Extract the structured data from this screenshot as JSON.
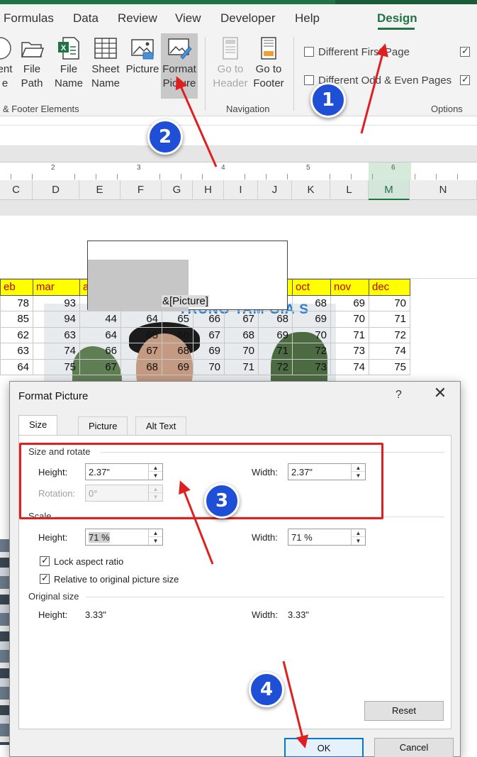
{
  "tabs": [
    {
      "label": "Formulas"
    },
    {
      "label": "Data"
    },
    {
      "label": "Review"
    },
    {
      "label": "View"
    },
    {
      "label": "Developer"
    },
    {
      "label": "Help"
    },
    {
      "label": "Design"
    }
  ],
  "ribbon": {
    "elements": {
      "current_line1": "ent",
      "current_line2": "e",
      "file_path_line1": "File",
      "file_path_line2": "Path",
      "file_name_line1": "File",
      "file_name_line2": "Name",
      "sheet_name_line1": "Sheet",
      "sheet_name_line2": "Name",
      "picture": "Picture",
      "format_picture_line1": "Format",
      "format_picture_line2": "Picture",
      "group_label": "& Footer Elements"
    },
    "navigation": {
      "goto_header_line1": "Go to",
      "goto_header_line2": "Header",
      "goto_footer_line1": "Go to",
      "goto_footer_line2": "Footer",
      "group_label": "Navigation"
    },
    "options": {
      "different_first_page": "Different First Page",
      "different_odd_even": "Different Odd & Even Pages",
      "group_label": "Options"
    }
  },
  "ruler": {
    "marks": [
      "2",
      "3",
      "4",
      "5",
      "6"
    ]
  },
  "columns": [
    "C",
    "D",
    "E",
    "F",
    "G",
    "H",
    "I",
    "J",
    "K",
    "L",
    "M",
    "N"
  ],
  "sheet": {
    "header_code": "&[Picture]",
    "watermark_text": "TRUNG TAM GIA S",
    "month_headers": [
      "eb",
      "mar",
      "a",
      "",
      "",
      "",
      "",
      "",
      "oct",
      "nov",
      "dec"
    ],
    "rows": [
      [
        "78",
        "93",
        "",
        "",
        "",
        "",
        "",
        "",
        "68",
        "69",
        "70"
      ],
      [
        "85",
        "94",
        "44",
        "64",
        "65",
        "66",
        "67",
        "68",
        "69",
        "70",
        "71"
      ],
      [
        "62",
        "63",
        "64",
        "65",
        "66",
        "67",
        "68",
        "69",
        "70",
        "71",
        "72"
      ],
      [
        "63",
        "74",
        "66",
        "67",
        "68",
        "69",
        "70",
        "71",
        "72",
        "73",
        "74"
      ],
      [
        "64",
        "75",
        "67",
        "68",
        "69",
        "70",
        "71",
        "72",
        "73",
        "74",
        "75"
      ]
    ]
  },
  "dialog": {
    "title": "Format Picture",
    "help": "?",
    "close": "✕",
    "tabs": [
      "Size",
      "Picture",
      "Alt Text"
    ],
    "size_rotate": {
      "section": "Size and rotate",
      "height_label": "Height:",
      "height_value": "2.37\"",
      "width_label": "Width:",
      "width_value": "2.37\"",
      "rotation_label": "Rotation:",
      "rotation_value": "0°"
    },
    "scale": {
      "section": "Scale",
      "height_label": "Height:",
      "height_value": "71 %",
      "width_label": "Width:",
      "width_value": "71 %",
      "lock_aspect": "Lock aspect ratio",
      "relative_original": "Relative to original picture size"
    },
    "original": {
      "section": "Original size",
      "height_label": "Height:",
      "height_value": "3.33\"",
      "width_label": "Width:",
      "width_value": "3.33\""
    },
    "reset": "Reset",
    "ok": "OK",
    "cancel": "Cancel"
  },
  "annotations": {
    "badges": [
      "1",
      "2",
      "3",
      "4"
    ],
    "color": "#e02020",
    "badge_color": "#1f4fd6"
  }
}
